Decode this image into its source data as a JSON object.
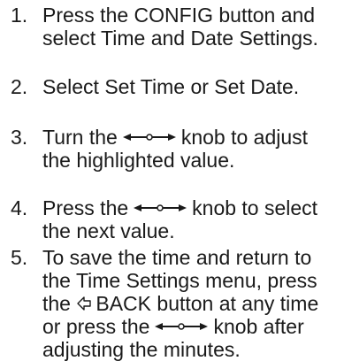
{
  "steps": [
    {
      "number": "1.",
      "lines": [
        "Press the CONFIG button and",
        "select Time and Date Settings."
      ]
    },
    {
      "number": "2.",
      "lines": [
        "Select Set Time or Set Date."
      ]
    },
    {
      "number": "3.",
      "lines": [
        {
          "before": "Turn the",
          "after": "knob to adjust"
        },
        "the highlighted value."
      ]
    },
    {
      "number": "4.",
      "lines": [
        {
          "before": "Press the",
          "after": "knob to select"
        },
        "the next value."
      ]
    },
    {
      "number": "5.",
      "lines": [
        "To save the time and return to",
        "the Time Settings menu, press",
        {
          "before": "the",
          "back_label": "BACK button at any time"
        },
        {
          "before": "or press the",
          "after": "knob after"
        },
        "adjusting the minutes."
      ]
    }
  ],
  "icons": {
    "knob": "knob-icon",
    "back": "back-arrow-icon"
  }
}
